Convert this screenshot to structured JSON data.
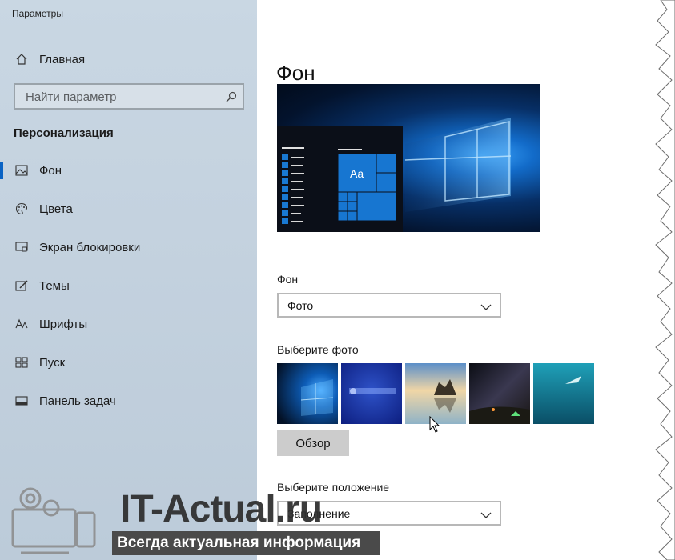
{
  "app": {
    "title": "Параметры"
  },
  "sidebar": {
    "home": {
      "label": "Главная",
      "icon": "home-icon"
    },
    "search": {
      "placeholder": "Найти параметр",
      "icon": "search-icon"
    },
    "section": "Персонализация",
    "items": [
      {
        "label": "Фон",
        "icon": "picture-icon",
        "active": true
      },
      {
        "label": "Цвета",
        "icon": "palette-icon"
      },
      {
        "label": "Экран блокировки",
        "icon": "lock-screen-icon"
      },
      {
        "label": "Темы",
        "icon": "themes-icon"
      },
      {
        "label": "Шрифты",
        "icon": "fonts-icon"
      },
      {
        "label": "Пуск",
        "icon": "start-icon"
      },
      {
        "label": "Панель задач",
        "icon": "taskbar-icon"
      }
    ]
  },
  "main": {
    "title": "Фон",
    "preview": {
      "tile_text": "Aa"
    },
    "background": {
      "label": "Фон",
      "value": "Фото"
    },
    "photos": {
      "label": "Выберите фото",
      "thumbnails": [
        "windows-light-photo",
        "it-actual-wallpaper-photo",
        "beach-rocks-photo",
        "night-sky-photo",
        "underwater-photo"
      ],
      "browse_label": "Обзор"
    },
    "fit": {
      "label": "Выберите положение",
      "value": "Заполнение"
    }
  },
  "watermark": {
    "brand": "IT-Actual.ru",
    "tagline": "Всегда актуальная информация"
  },
  "colors": {
    "accent": "#0a63c4",
    "sidebar_bg": "#c4d2df",
    "button_bg": "#cccccc"
  }
}
